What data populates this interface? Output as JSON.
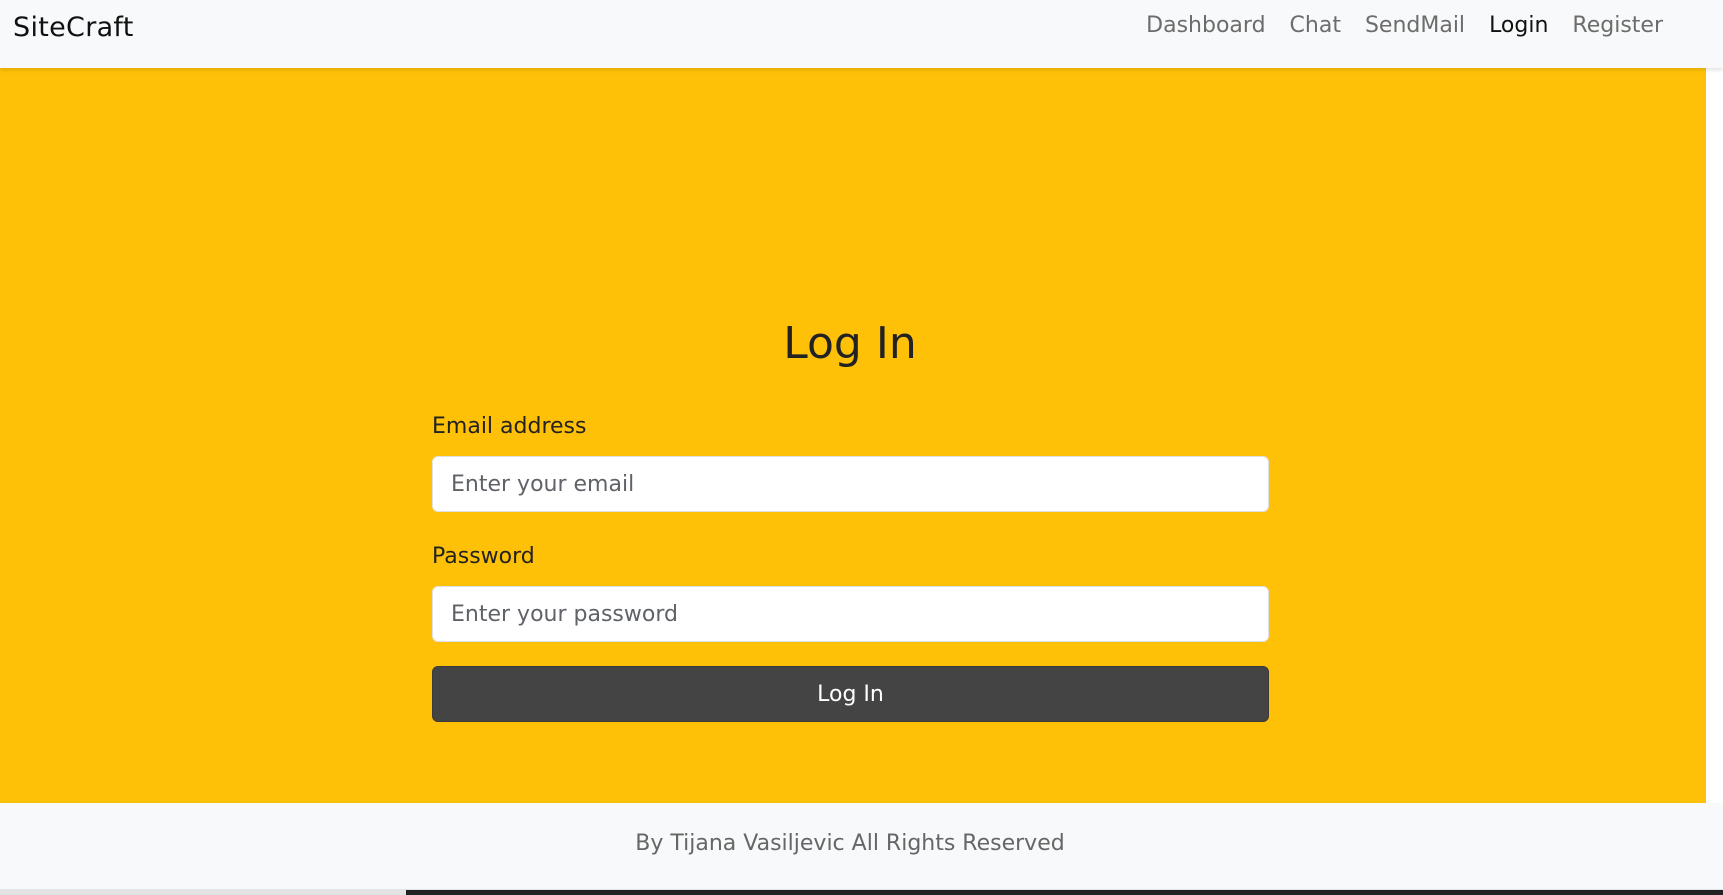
{
  "navbar": {
    "brand": "SiteCraft",
    "links": [
      {
        "label": "Dashboard"
      },
      {
        "label": "Chat"
      },
      {
        "label": "SendMail"
      },
      {
        "label": "Login"
      },
      {
        "label": "Register"
      }
    ],
    "active": "Login"
  },
  "main": {
    "title": "Log In",
    "email_label": "Email address",
    "email_placeholder": "Enter your email",
    "email_value": "",
    "password_label": "Password",
    "password_placeholder": "Enter your password",
    "password_value": "",
    "submit_label": "Log In"
  },
  "footer": {
    "text": "By Tijana Vasiljevic All Rights Reserved"
  },
  "colors": {
    "accent": "#ffc107",
    "button": "#444444",
    "navbar": "#f8f9fa"
  }
}
